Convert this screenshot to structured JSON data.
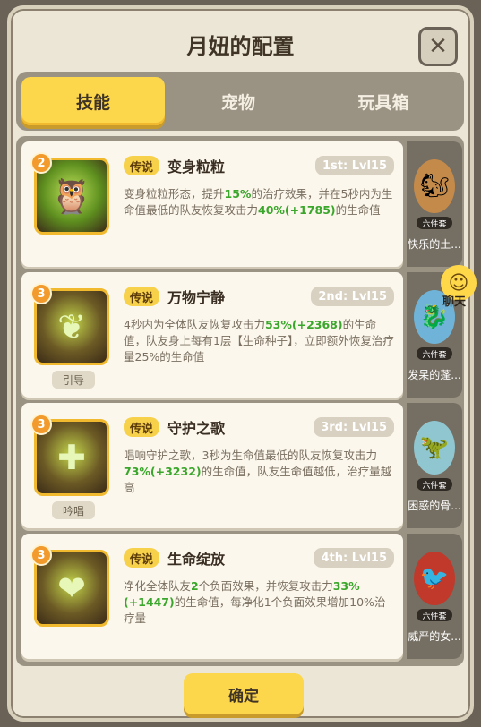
{
  "dialog": {
    "title": "月妞的配置",
    "close_icon": "close-icon"
  },
  "tabs": [
    {
      "label": "技能",
      "active": true
    },
    {
      "label": "宠物",
      "active": false
    },
    {
      "label": "玩具箱",
      "active": false
    }
  ],
  "skills": [
    {
      "level": "2",
      "icon": "owl-icon",
      "rarity": "传说",
      "name": "变身粒粒",
      "rank": "1st: Lvl15",
      "desc": [
        "变身粒粒形态，提升",
        "15%",
        "的治疗效果，并在5秒内为生命值最低的队友恢复攻击力",
        "40%(+1785)",
        "的生命值"
      ]
    },
    {
      "level": "3",
      "icon": "heart-sprout-icon",
      "rarity": "传说",
      "name": "万物宁静",
      "rank": "2nd: Lvl15",
      "subtag": "引导",
      "desc": [
        "4秒内为全体队友恢复攻击力",
        "53%(+2368)",
        "的生命值，队友身上每有1层【生命种子】，立即额外恢复治疗量25%的生命值",
        "",
        ""
      ]
    },
    {
      "level": "3",
      "icon": "shield-cross-icon",
      "rarity": "传说",
      "name": "守护之歌",
      "rank": "3rd: Lvl15",
      "subtag": "吟唱",
      "desc": [
        "唱响守护之歌，3秒为生命值最低的队友恢复攻击力",
        "73%(+3232)",
        "的生命值，队友生命值越低，治疗量越高",
        "",
        ""
      ]
    },
    {
      "level": "3",
      "icon": "heart-flower-icon",
      "rarity": "传说",
      "name": "生命绽放",
      "rank": "4th: Lvl15",
      "desc": [
        "净化全体队友",
        "2",
        "个负面效果，并恢复攻击力",
        "33%(+1447)",
        "的生命值，每净化1个负面效果增加10%治疗量"
      ]
    }
  ],
  "pets": [
    {
      "tag": "六件套",
      "name": "快乐的土..."
    },
    {
      "tag": "六件套",
      "name": "发呆的蓬..."
    },
    {
      "tag": "六件套",
      "name": "困惑的骨..."
    },
    {
      "tag": "六件套",
      "name": "威严的女..."
    }
  ],
  "chat": {
    "label": "聊天"
  },
  "confirm_label": "确定"
}
